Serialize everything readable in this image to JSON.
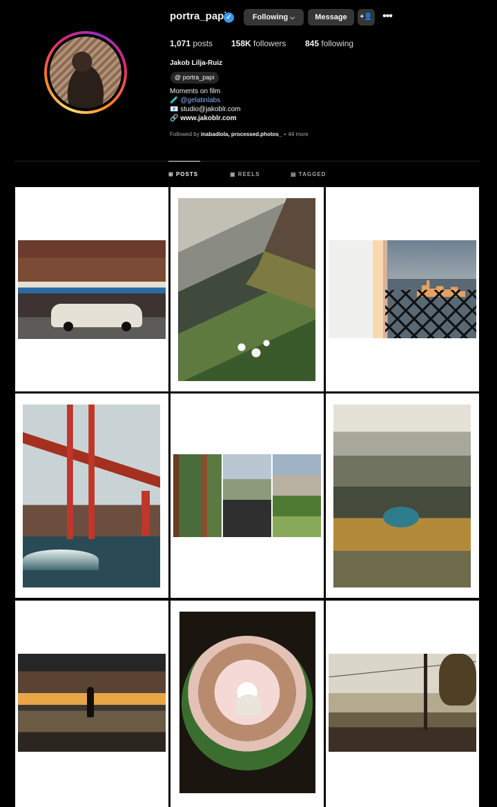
{
  "profile": {
    "username": "portra_papi",
    "verified_icon": "verified-badge-icon",
    "buttons": {
      "following": "Following",
      "following_caret": "⌵",
      "message": "Message",
      "suggest": "+",
      "more": "•••"
    },
    "stats": {
      "posts_count": "1,071",
      "posts_label": "posts",
      "followers_count": "158K",
      "followers_label": "followers",
      "following_count": "845",
      "following_label": "following"
    },
    "full_name": "Jakob Lilja-Ruiz",
    "threads_badge": "portra_papi",
    "bio": {
      "line1": "Moments on film",
      "line2_emoji": "🧪",
      "line2_link": "@gelatinlabs",
      "line3": "📧 studio@jakoblr.com",
      "line4_icon": "🔗",
      "line4": "www.jakoblr.com"
    },
    "followed_by": {
      "prefix": "Followed by ",
      "names": "inabadiola, processed.photos_",
      "suffix": " + 44 more"
    }
  },
  "tabs": [
    {
      "label": "POSTS",
      "icon": "⊞",
      "active": true
    },
    {
      "label": "REELS",
      "icon": "▣",
      "active": false
    },
    {
      "label": "TAGGED",
      "icon": "▤",
      "active": false
    }
  ],
  "grid": {
    "posts": [
      {
        "subject": "italian-specialties-storefront"
      },
      {
        "subject": "coastal-cliff-flowers"
      },
      {
        "subject": "city-skyline-fence"
      },
      {
        "subject": "golden-gate-bridge-surfer"
      },
      {
        "subject": "yosemite-triptych"
      },
      {
        "subject": "mountain-lake-vista"
      },
      {
        "subject": "sunset-beach-silhouette"
      },
      {
        "subject": "fisheye-cherry-blossom-capitol"
      },
      {
        "subject": "waterfront-street-sunrise"
      }
    ]
  },
  "colors": {
    "background": "#000000",
    "button_bg": "#363636",
    "verified": "#3897f0",
    "link": "#8ab4f8",
    "muted": "#a8a8a8"
  }
}
